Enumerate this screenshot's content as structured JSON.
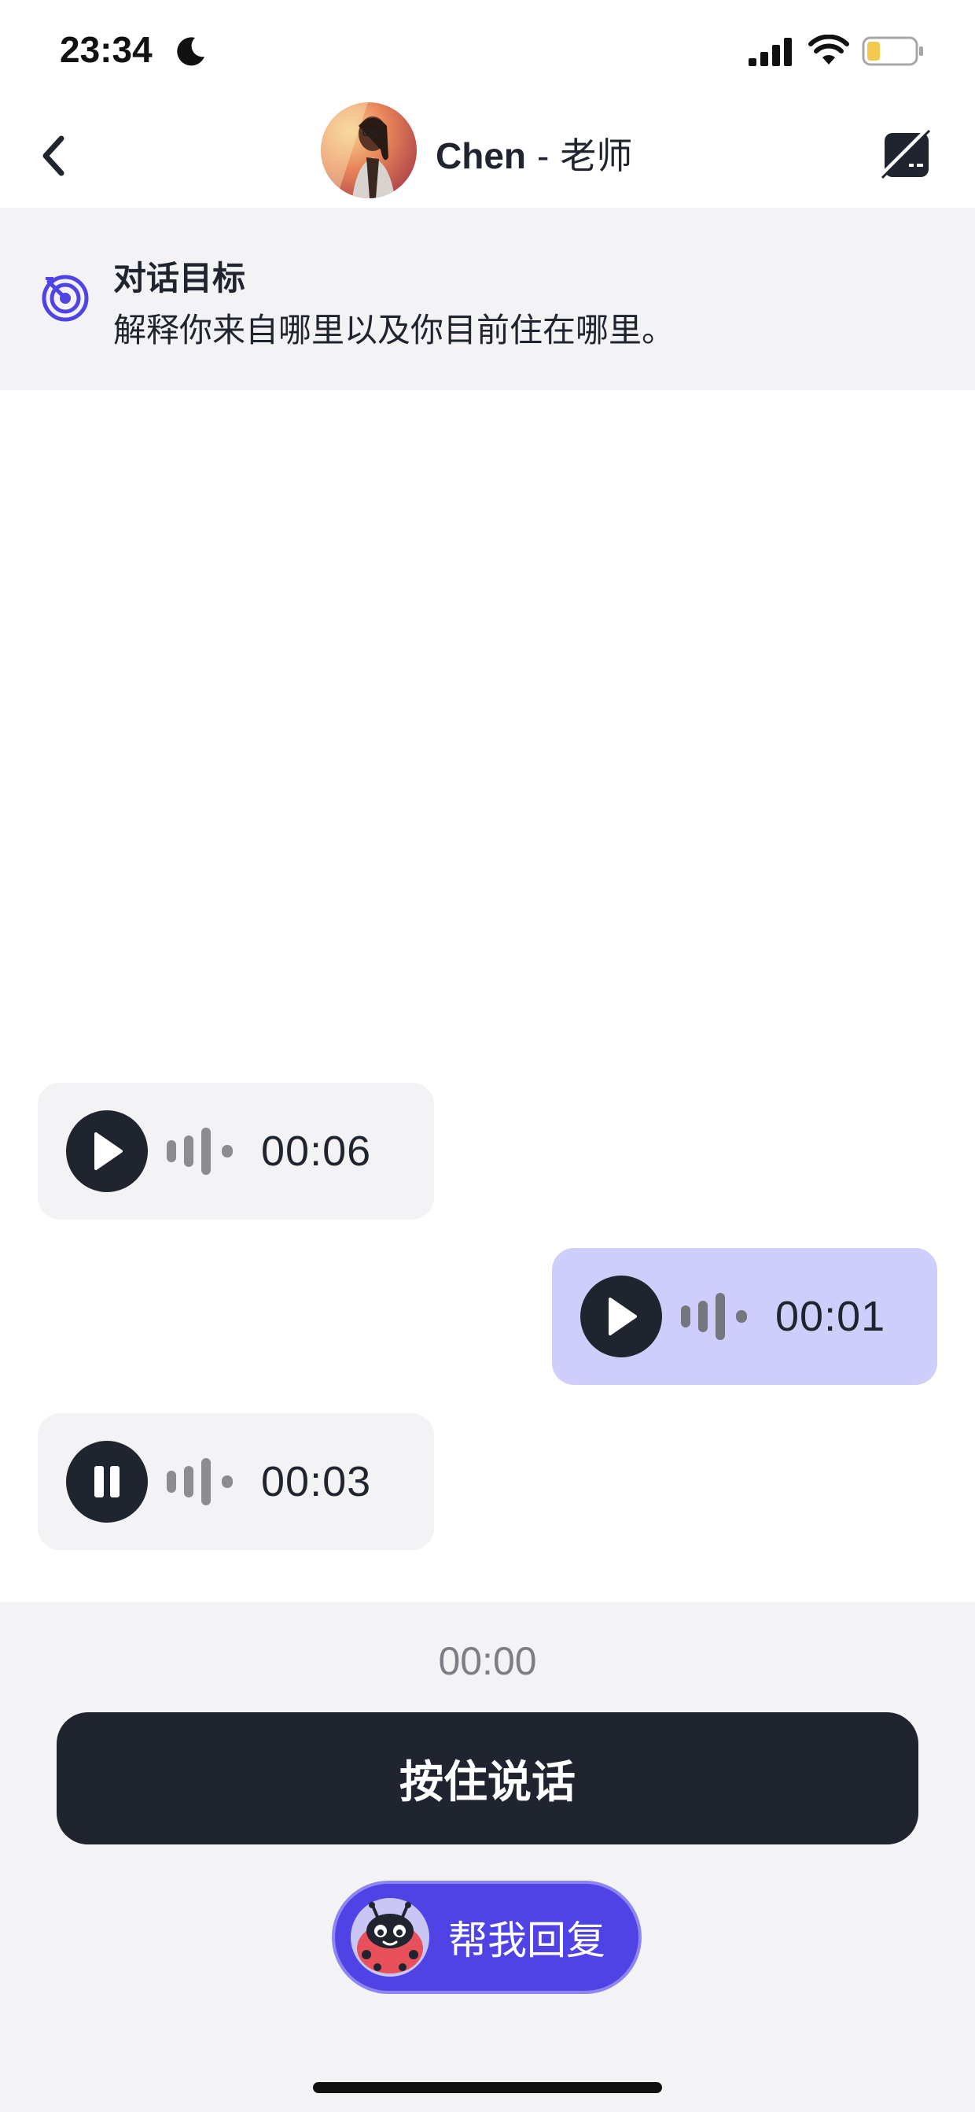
{
  "status_bar": {
    "time": "23:34"
  },
  "header": {
    "name": "Chen",
    "separator": "-",
    "role": "老师"
  },
  "goal": {
    "title": "对话目标",
    "text": "解释你来自哪里以及你目前住在哪里。"
  },
  "messages": [
    {
      "side": "incoming",
      "state": "play",
      "duration": "00:06"
    },
    {
      "side": "outgoing",
      "state": "play",
      "duration": "00:01"
    },
    {
      "side": "incoming",
      "state": "pause",
      "duration": "00:03"
    }
  ],
  "recorder": {
    "timer": "00:00",
    "hold_label": "按住说话",
    "help_label": "帮我回复"
  },
  "colors": {
    "dark": "#20242f",
    "accent": "#4f43e6",
    "outgoing_bubble": "#cfcdfa",
    "incoming_bubble": "#f3f3f6",
    "panel": "#f3f3f6"
  },
  "icons": {
    "back": "chevron-left-icon",
    "translation_toggle": "no-translation-icon",
    "goal": "target-icon",
    "play": "play-icon",
    "pause": "pause-icon",
    "waveform": "waveform-icon"
  }
}
